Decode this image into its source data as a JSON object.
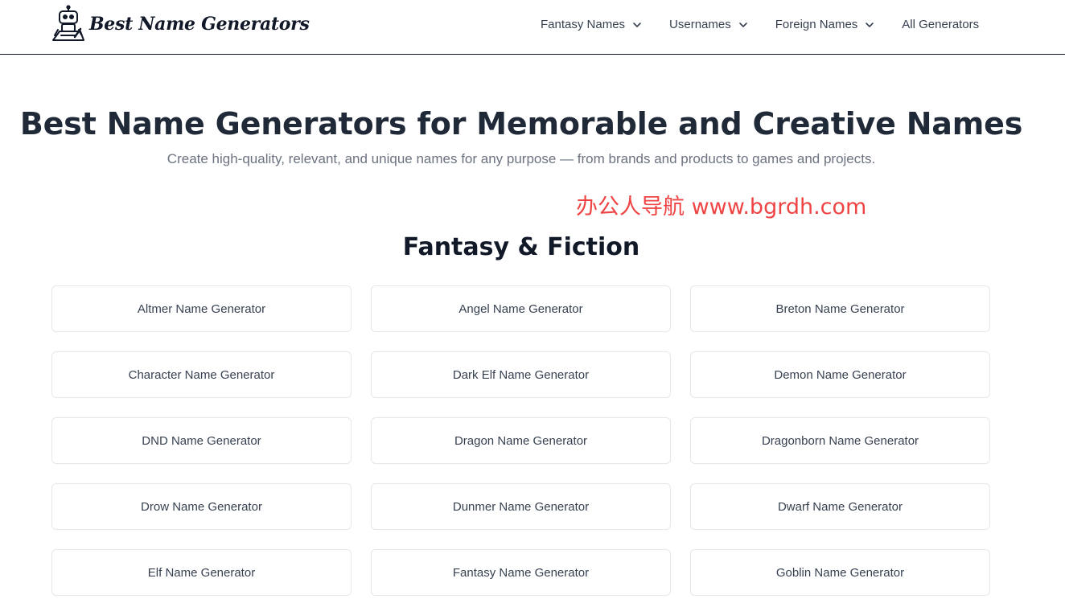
{
  "header": {
    "logo_text": "Best Name Generators",
    "logo_icon": "robot-writing-icon",
    "nav": [
      {
        "label": "Fantasy Names",
        "icon": "chevron-down-icon"
      },
      {
        "label": "Usernames",
        "icon": "chevron-down-icon"
      },
      {
        "label": "Foreign Names",
        "icon": "chevron-down-icon"
      },
      {
        "label": "All Generators"
      }
    ]
  },
  "hero": {
    "title": "Best Name Generators for Memorable and Creative Names",
    "subtitle": "Create high-quality, relevant, and unique names for any purpose — from brands and products to games and projects."
  },
  "watermark": "办公人导航 www.bgrdh.com",
  "section": {
    "title": "Fantasy & Fiction",
    "generators": [
      "Altmer Name Generator",
      "Angel Name Generator",
      "Breton Name Generator",
      "Character Name Generator",
      "Dark Elf Name Generator",
      "Demon Name Generator",
      "DND Name Generator",
      "Dragon Name Generator",
      "Dragonborn Name Generator",
      "Drow Name Generator",
      "Dunmer Name Generator",
      "Dwarf Name Generator",
      "Elf Name Generator",
      "Fantasy Name Generator",
      "Goblin Name Generator"
    ]
  },
  "colors": {
    "text_dark": "#1f2937",
    "text_muted": "#6b7280",
    "watermark": "#ef4444",
    "card_border": "#e5e7eb"
  }
}
